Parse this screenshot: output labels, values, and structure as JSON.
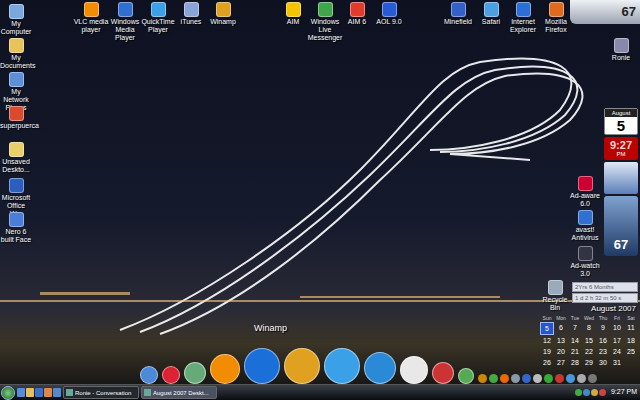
{
  "desktop_icons": [
    {
      "label": "My Computer"
    },
    {
      "label": "My Documents"
    },
    {
      "label": "My Network Places"
    },
    {
      "label": "superpuerca"
    },
    {
      "label": "Unsaved Deskto..."
    },
    {
      "label": "Microsoft Office W..."
    },
    {
      "label": "Nero 6 built Face"
    }
  ],
  "top_icons": [
    {
      "label": "VLC media player"
    },
    {
      "label": "Windows Media Player"
    },
    {
      "label": "QuickTime Player"
    },
    {
      "label": "iTunes"
    },
    {
      "label": "Winamp"
    },
    {
      "label": "AIM"
    },
    {
      "label": "Windows Live Messenger"
    },
    {
      "label": "AIM 6"
    },
    {
      "label": "AOL 9.0"
    },
    {
      "label": "Minefield"
    },
    {
      "label": "Safari"
    },
    {
      "label": "Internet Explorer"
    },
    {
      "label": "Mozilla Firefox"
    }
  ],
  "right_icons": [
    {
      "label": "Ronie"
    },
    {
      "label": "Ad-aware 6.0"
    },
    {
      "label": "avast! Antivirus"
    },
    {
      "label": "Ad-watch 3.0"
    },
    {
      "label": "Recycle Bin"
    }
  ],
  "weather_top": {
    "temp": "67"
  },
  "day_gadget": {
    "month": "August",
    "day": "5"
  },
  "clock_gadget": {
    "time": "9:27",
    "ampm": "PM"
  },
  "weather_gadget": {
    "temp": "67"
  },
  "countdown": {
    "lines": [
      "2Yrs 6 Months",
      "1 d 2 h 32 m 50 s"
    ]
  },
  "calendar": {
    "title": "August 2007",
    "weekdays": [
      "Sun",
      "Mon",
      "Tue",
      "Wed",
      "Thu",
      "Fri",
      "Sat"
    ],
    "weeks": [
      [
        {
          "day": "5",
          "selected": true
        },
        {
          "day": "6",
          "selected": false
        },
        {
          "day": "7",
          "selected": false
        },
        {
          "day": "8",
          "selected": false
        },
        {
          "day": "9",
          "selected": false
        },
        {
          "day": "10",
          "selected": false
        },
        {
          "day": "11",
          "selected": false
        }
      ],
      [
        {
          "day": "12",
          "selected": false
        },
        {
          "day": "13",
          "selected": false
        },
        {
          "day": "14",
          "selected": false
        },
        {
          "day": "15",
          "selected": false
        },
        {
          "day": "16",
          "selected": false
        },
        {
          "day": "17",
          "selected": false
        },
        {
          "day": "18",
          "selected": false
        }
      ],
      [
        {
          "day": "19",
          "selected": false
        },
        {
          "day": "20",
          "selected": false
        },
        {
          "day": "21",
          "selected": false
        },
        {
          "day": "22",
          "selected": false
        },
        {
          "day": "23",
          "selected": false
        },
        {
          "day": "24",
          "selected": false
        },
        {
          "day": "25",
          "selected": false
        }
      ],
      [
        {
          "day": "26",
          "selected": false
        },
        {
          "day": "27",
          "selected": false
        },
        {
          "day": "28",
          "selected": false
        },
        {
          "day": "29",
          "selected": false
        },
        {
          "day": "30",
          "selected": false
        },
        {
          "day": "31",
          "selected": false
        }
      ]
    ]
  },
  "dock": {
    "label": "Winamp"
  },
  "taskbar": {
    "tasks": [
      {
        "label": "Ronie - Conversation",
        "selected": false
      },
      {
        "label": "August 2007 Deskt...",
        "selected": true
      }
    ],
    "clock": "9:27 PM"
  }
}
